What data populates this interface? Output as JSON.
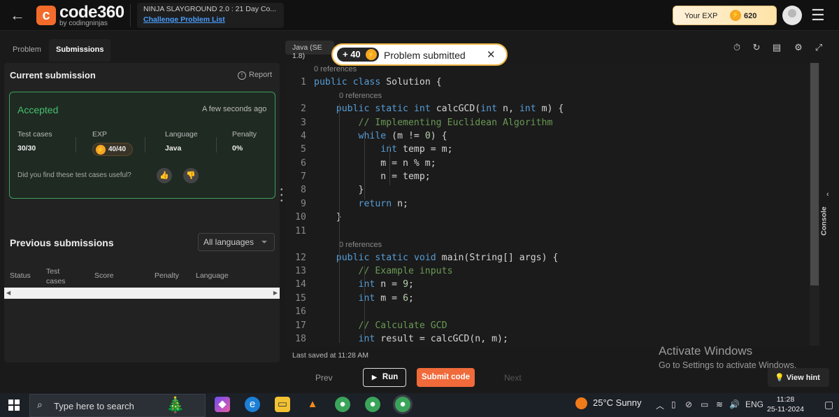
{
  "header": {
    "back_icon": "←",
    "logo_name": "code360",
    "logo_by": "by codingninjas",
    "breadcrumb_title": "NINJA SLAYGROUND 2.0 : 21 Day Co...",
    "breadcrumb_link": "Challenge Problem List",
    "exp_label": "Your EXP",
    "exp_value": "620",
    "menu_icon": "☰"
  },
  "left_tabs": {
    "problem": "Problem",
    "submissions": "Submissions"
  },
  "current": {
    "title": "Current submission",
    "report": "Report",
    "status": "Accepted",
    "time": "A few seconds ago",
    "headers": {
      "tests": "Test cases",
      "exp": "EXP",
      "language": "Language",
      "penalty": "Penalty"
    },
    "values": {
      "tests": "30/30",
      "exp": "40/40",
      "language": "Java",
      "penalty": "0%"
    },
    "useful_question": "Did you find these test cases useful?"
  },
  "previous": {
    "title": "Previous submissions",
    "filter": "All languages",
    "columns": [
      "Status",
      "Test\ncases",
      "Score",
      "Penalty",
      "Language"
    ]
  },
  "editor": {
    "language": "Java (SE 1.8)",
    "toast_points": "+ 40",
    "toast_message": "Problem submitted",
    "toast_close": "✕",
    "references": "0 references",
    "lines": [
      {
        "n": "1",
        "code": "public class Solution {"
      },
      {
        "n": "2",
        "code": "    public static int calcGCD(int n, int m) {"
      },
      {
        "n": "3",
        "code": "        // Implementing Euclidean Algorithm"
      },
      {
        "n": "4",
        "code": "        while (m != 0) {"
      },
      {
        "n": "5",
        "code": "            int temp = m;"
      },
      {
        "n": "6",
        "code": "            m = n % m;"
      },
      {
        "n": "7",
        "code": "            n = temp;"
      },
      {
        "n": "8",
        "code": "        }"
      },
      {
        "n": "9",
        "code": "        return n;"
      },
      {
        "n": "10",
        "code": "    }"
      },
      {
        "n": "11",
        "code": ""
      },
      {
        "n": "12",
        "code": "    public static void main(String[] args) {"
      },
      {
        "n": "13",
        "code": "        // Example inputs"
      },
      {
        "n": "14",
        "code": "        int n = 9;"
      },
      {
        "n": "15",
        "code": "        int m = 6;"
      },
      {
        "n": "16",
        "code": ""
      },
      {
        "n": "17",
        "code": "        // Calculate GCD"
      },
      {
        "n": "18",
        "code": "        int result = calcGCD(n, m);"
      }
    ],
    "console_label": "Console",
    "saved": "Last saved at 11:28 AM"
  },
  "footer": {
    "prev": "Prev",
    "run": "Run",
    "submit": "Submit code",
    "next": "Next",
    "hint": "View hint"
  },
  "watermark": {
    "title": "Activate Windows",
    "subtitle": "Go to Settings to activate Windows."
  },
  "taskbar": {
    "search_placeholder": "Type here to search",
    "weather": "25°C  Sunny",
    "language": "ENG",
    "time": "11:28",
    "date": "25-11-2024"
  },
  "colors": {
    "accent": "#f06a3a",
    "accepted": "#45c070",
    "keyword": "#569cd6",
    "comment": "#6a9955",
    "number": "#b5cea8"
  }
}
